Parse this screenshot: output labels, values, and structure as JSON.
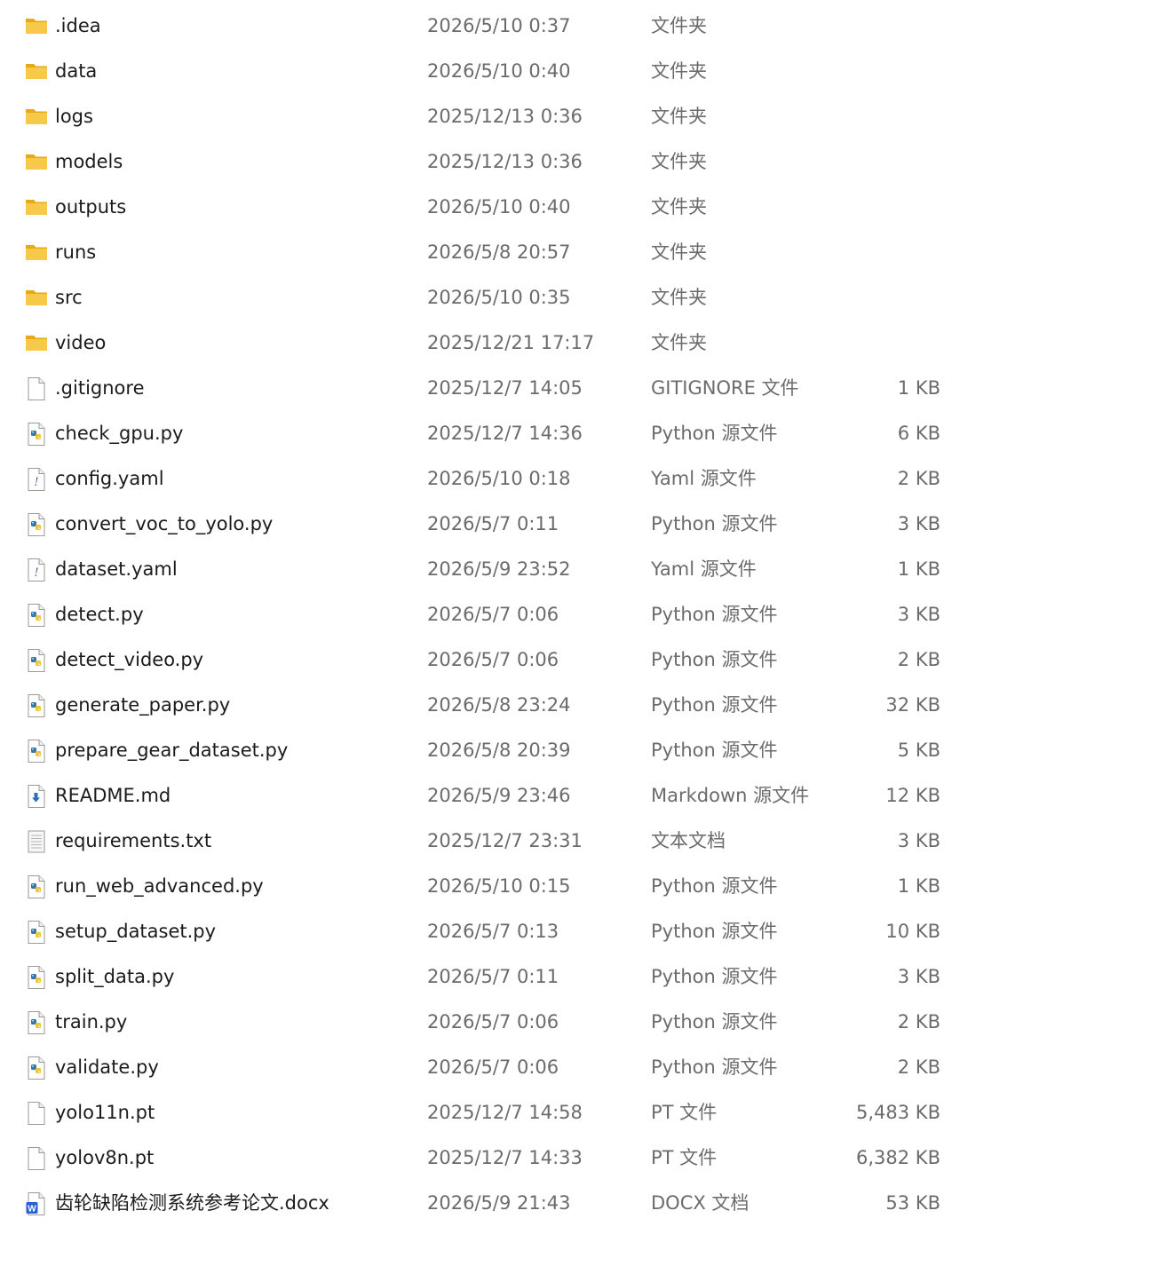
{
  "colors": {
    "folder": "#f7c948",
    "folder_dark": "#e8a916",
    "python_blue": "#3a76a8",
    "python_yellow": "#f2c53d",
    "yaml_purple": "#7b4fa3",
    "markdown_blue": "#2d6fb7",
    "word_blue": "#2b5fd9"
  },
  "files": [
    {
      "name": ".idea",
      "date": "2026/5/10 0:37",
      "type": "文件夹",
      "size": "",
      "icon": "folder-icon"
    },
    {
      "name": "data",
      "date": "2026/5/10 0:40",
      "type": "文件夹",
      "size": "",
      "icon": "folder-icon"
    },
    {
      "name": "logs",
      "date": "2025/12/13 0:36",
      "type": "文件夹",
      "size": "",
      "icon": "folder-icon"
    },
    {
      "name": "models",
      "date": "2025/12/13 0:36",
      "type": "文件夹",
      "size": "",
      "icon": "folder-icon"
    },
    {
      "name": "outputs",
      "date": "2026/5/10 0:40",
      "type": "文件夹",
      "size": "",
      "icon": "folder-icon"
    },
    {
      "name": "runs",
      "date": "2026/5/8 20:57",
      "type": "文件夹",
      "size": "",
      "icon": "folder-icon"
    },
    {
      "name": "src",
      "date": "2026/5/10 0:35",
      "type": "文件夹",
      "size": "",
      "icon": "folder-icon"
    },
    {
      "name": "video",
      "date": "2025/12/21 17:17",
      "type": "文件夹",
      "size": "",
      "icon": "folder-icon"
    },
    {
      "name": ".gitignore",
      "date": "2025/12/7 14:05",
      "type": "GITIGNORE 文件",
      "size": "1 KB",
      "icon": "blank-file-icon"
    },
    {
      "name": "check_gpu.py",
      "date": "2025/12/7 14:36",
      "type": "Python 源文件",
      "size": "6 KB",
      "icon": "python-file-icon"
    },
    {
      "name": "config.yaml",
      "date": "2026/5/10 0:18",
      "type": "Yaml 源文件",
      "size": "2 KB",
      "icon": "yaml-file-icon"
    },
    {
      "name": "convert_voc_to_yolo.py",
      "date": "2026/5/7 0:11",
      "type": "Python 源文件",
      "size": "3 KB",
      "icon": "python-file-icon"
    },
    {
      "name": "dataset.yaml",
      "date": "2026/5/9 23:52",
      "type": "Yaml 源文件",
      "size": "1 KB",
      "icon": "yaml-file-icon"
    },
    {
      "name": "detect.py",
      "date": "2026/5/7 0:06",
      "type": "Python 源文件",
      "size": "3 KB",
      "icon": "python-file-icon"
    },
    {
      "name": "detect_video.py",
      "date": "2026/5/7 0:06",
      "type": "Python 源文件",
      "size": "2 KB",
      "icon": "python-file-icon"
    },
    {
      "name": "generate_paper.py",
      "date": "2026/5/8 23:24",
      "type": "Python 源文件",
      "size": "32 KB",
      "icon": "python-file-icon"
    },
    {
      "name": "prepare_gear_dataset.py",
      "date": "2026/5/8 20:39",
      "type": "Python 源文件",
      "size": "5 KB",
      "icon": "python-file-icon"
    },
    {
      "name": "README.md",
      "date": "2026/5/9 23:46",
      "type": "Markdown 源文件",
      "size": "12 KB",
      "icon": "markdown-file-icon"
    },
    {
      "name": "requirements.txt",
      "date": "2025/12/7 23:31",
      "type": "文本文档",
      "size": "3 KB",
      "icon": "text-file-icon"
    },
    {
      "name": "run_web_advanced.py",
      "date": "2026/5/10 0:15",
      "type": "Python 源文件",
      "size": "1 KB",
      "icon": "python-file-icon"
    },
    {
      "name": "setup_dataset.py",
      "date": "2026/5/7 0:13",
      "type": "Python 源文件",
      "size": "10 KB",
      "icon": "python-file-icon"
    },
    {
      "name": "split_data.py",
      "date": "2026/5/7 0:11",
      "type": "Python 源文件",
      "size": "3 KB",
      "icon": "python-file-icon"
    },
    {
      "name": "train.py",
      "date": "2026/5/7 0:06",
      "type": "Python 源文件",
      "size": "2 KB",
      "icon": "python-file-icon"
    },
    {
      "name": "validate.py",
      "date": "2026/5/7 0:06",
      "type": "Python 源文件",
      "size": "2 KB",
      "icon": "python-file-icon"
    },
    {
      "name": "yolo11n.pt",
      "date": "2025/12/7 14:58",
      "type": "PT 文件",
      "size": "5,483 KB",
      "icon": "blank-file-icon"
    },
    {
      "name": "yolov8n.pt",
      "date": "2025/12/7 14:33",
      "type": "PT 文件",
      "size": "6,382 KB",
      "icon": "blank-file-icon"
    },
    {
      "name": "齿轮缺陷检测系统参考论文.docx",
      "date": "2026/5/9 21:43",
      "type": "DOCX 文档",
      "size": "53 KB",
      "icon": "word-document-icon"
    }
  ]
}
